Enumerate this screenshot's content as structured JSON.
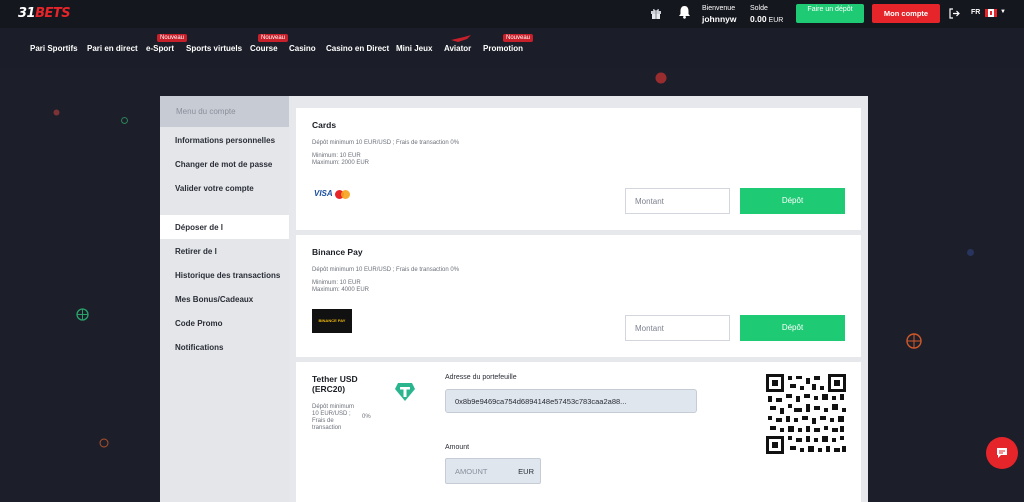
{
  "header": {
    "logo_part1": "31",
    "logo_part2": "BETS",
    "welcome_label": "Bienvenue",
    "username": "johnnyw",
    "balance_label": "Solde",
    "balance_value": "0.00",
    "balance_currency": "EUR",
    "deposit_button": "Faire un dépôt",
    "account_button": "Mon compte",
    "language": "FR"
  },
  "nav": {
    "items": [
      {
        "label": "Pari Sportifs"
      },
      {
        "label": "Pari en direct"
      },
      {
        "label": "e-Sport",
        "badge": "Nouveau"
      },
      {
        "label": "Sports virtuels"
      },
      {
        "label": "Course",
        "badge": "Nouveau"
      },
      {
        "label": "Casino"
      },
      {
        "label": "Casino en Direct"
      },
      {
        "label": "Mini Jeux"
      },
      {
        "label": "Aviator"
      },
      {
        "label": "Promotion",
        "badge": "Nouveau"
      }
    ]
  },
  "sidebar": {
    "header": "Menu du compte",
    "items": [
      {
        "label": "Informations personnelles"
      },
      {
        "label": "Changer de mot de passe"
      },
      {
        "label": "Valider votre compte"
      },
      {
        "label": "Déposer de l"
      },
      {
        "label": "Retirer de l"
      },
      {
        "label": "Historique des transactions"
      },
      {
        "label": "Mes Bonus/Cadeaux"
      },
      {
        "label": "Code Promo"
      },
      {
        "label": "Notifications"
      }
    ],
    "active_index": 3
  },
  "methods": {
    "cards": {
      "title": "Cards",
      "fees": "Dépôt minimum 10 EUR/USD ; Frais de transaction 0%",
      "minimum": "Minimum: 10 EUR",
      "maximum": "Maximum: 2000 EUR",
      "brand_visa": "VISA",
      "amount_placeholder": "Montant",
      "button": "Dépôt"
    },
    "binance": {
      "title": "Binance Pay",
      "fees": "Dépôt minimum 10 EUR/USD ; Frais de transaction 0%",
      "minimum": "Minimum: 10 EUR",
      "maximum": "Maximum: 4000 EUR",
      "logo_text": "BINANCE PAY",
      "amount_placeholder": "Montant",
      "button": "Dépôt"
    },
    "tether": {
      "title_line1": "Tether USD",
      "title_line2": "(ERC20)",
      "fees_line1": "Dépôt minimum",
      "fees_line2": "10 EUR/USD ;",
      "fees_line3": "Frais de",
      "fees_line4": "transaction",
      "fee_value": "0%",
      "wallet_label": "Adresse du portefeuille",
      "wallet_address": "0x8b9e9469ca754d6894148e57453c783caa2a88...",
      "amount_label": "Amount",
      "amount_placeholder": "AMOUNT",
      "amount_currency": "EUR"
    }
  },
  "colors": {
    "accent_green": "#1ecb74",
    "accent_red": "#e5252a",
    "header_bg": "#15171f"
  }
}
